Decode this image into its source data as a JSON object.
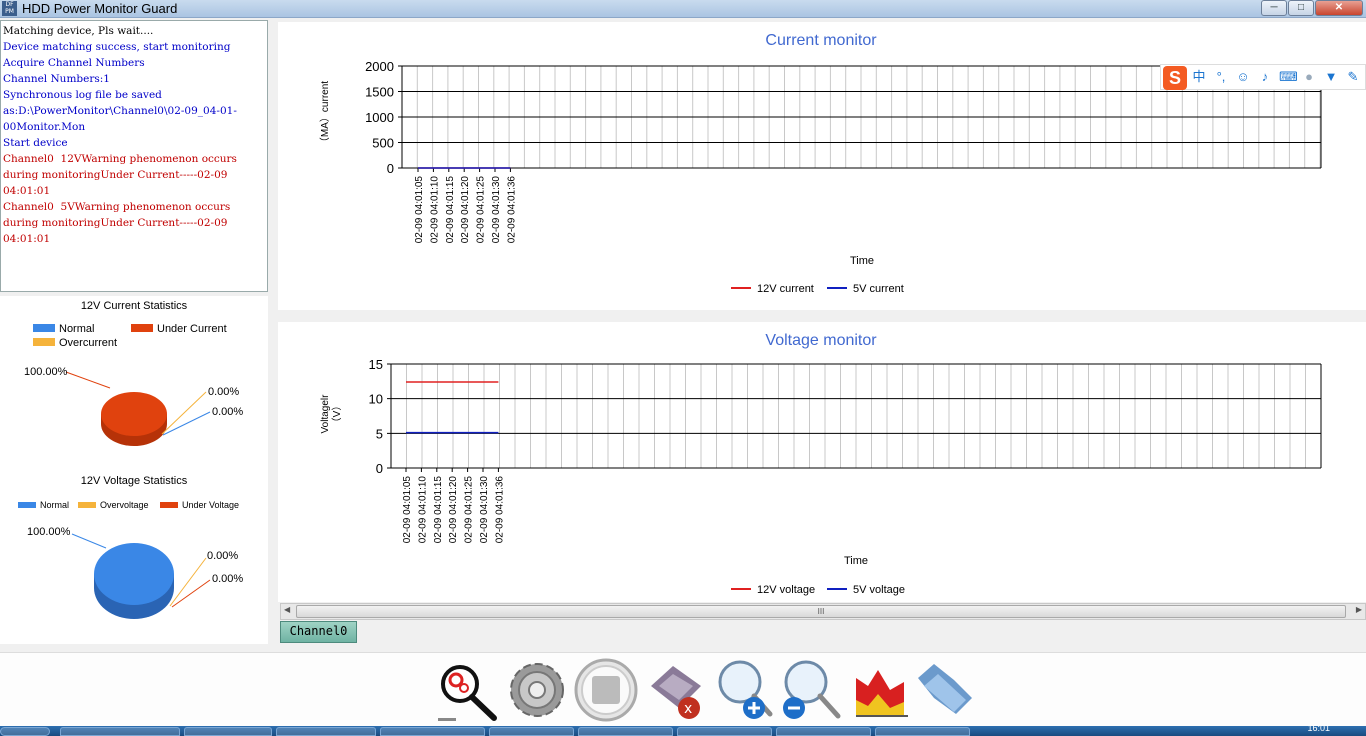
{
  "window": {
    "title": "HDD Power  Monitor Guard",
    "icon_text": "DF\nPM",
    "min": "─",
    "max": "□",
    "close": "✕"
  },
  "log": [
    {
      "text": "Matching device, Pls wait....",
      "color": "black"
    },
    {
      "text": "Device matching success, start monitoring",
      "color": "blue"
    },
    {
      "text": "Acquire Channel Numbers",
      "color": "blue"
    },
    {
      "text": "Channel Numbers:1",
      "color": "blue"
    },
    {
      "text": "Synchronous log file be saved as:D:\\PowerMonitor\\Channel0\\02-09_04-01-00Monitor.Mon",
      "color": "blue"
    },
    {
      "text": "Start device",
      "color": "blue"
    },
    {
      "text": "Channel0  12VWarning phenomenon occurs during monitoringUnder Current-----02-09 04:01:01",
      "color": "red"
    },
    {
      "text": "Channel0  5VWarning phenomenon occurs during monitoringUnder Current-----02-09 04:01:01",
      "color": "red"
    }
  ],
  "current_stats": {
    "title": "12V Current Statistics",
    "legend": [
      {
        "label": "Normal",
        "color": "#3a87e6"
      },
      {
        "label": "Under Current",
        "color": "#e0420e"
      },
      {
        "label": "Overcurrent",
        "color": "#f5b33b"
      }
    ],
    "labels": [
      "100.00%",
      "0.00%",
      "0.00%"
    ]
  },
  "voltage_stats": {
    "title": "12V Voltage Statistics",
    "legend": [
      {
        "label": "Normal",
        "color": "#3a87e6"
      },
      {
        "label": "Overvoltage",
        "color": "#f5b33b"
      },
      {
        "label": "Under Voltage",
        "color": "#e0420e"
      }
    ],
    "labels": [
      "100.00%",
      "0.00%",
      "0.00%"
    ]
  },
  "chart_data": [
    {
      "type": "line",
      "title": "Current monitor",
      "xlabel": "Time",
      "ylabel": "（MA）current",
      "ylim": [
        0,
        2000
      ],
      "yticks": [
        0,
        500,
        1000,
        1500,
        2000
      ],
      "x": [
        "02-09 04:01:05",
        "02-09 04:01:10",
        "02-09 04:01:15",
        "02-09 04:01:20",
        "02-09 04:01:25",
        "02-09 04:01:30",
        "02-09 04:01:36"
      ],
      "series": [
        {
          "name": "12V current",
          "color": "#e02020",
          "values": [
            0,
            0,
            0,
            0,
            0,
            0,
            0
          ]
        },
        {
          "name": "5V current",
          "color": "#1020c0",
          "values": [
            0,
            0,
            0,
            0,
            0,
            0,
            0
          ]
        }
      ],
      "grid": true
    },
    {
      "type": "line",
      "title": "Voltage monitor",
      "xlabel": "Time",
      "ylabel": "Voltagelr\n（V）",
      "ylim": [
        0,
        15
      ],
      "yticks": [
        0,
        5,
        10,
        15
      ],
      "x": [
        "02-09 04:01:05",
        "02-09 04:01:10",
        "02-09 04:01:15",
        "02-09 04:01:20",
        "02-09 04:01:25",
        "02-09 04:01:30",
        "02-09 04:01:36"
      ],
      "series": [
        {
          "name": "12V voltage",
          "color": "#e02020",
          "values": [
            12.4,
            12.4,
            12.4,
            12.4,
            12.4,
            12.4,
            12.4
          ]
        },
        {
          "name": "5V voltage",
          "color": "#1020c0",
          "values": [
            5.1,
            5.1,
            5.1,
            5.1,
            5.1,
            5.1,
            5.1
          ]
        }
      ],
      "grid": true
    }
  ],
  "tab": {
    "label": "Channel0"
  },
  "scrollbar": {
    "thumb_grip": "III",
    "left_arrow": "◀",
    "right_arrow": "▶"
  },
  "toolbar": [
    {
      "name": "search-device-button",
      "icon": "magnifier-gear-icon"
    },
    {
      "name": "settings-button",
      "icon": "gear-icon"
    },
    {
      "name": "stop-button",
      "icon": "stop-icon"
    },
    {
      "name": "clear-button",
      "icon": "eraser-icon"
    },
    {
      "name": "zoom-in-button",
      "icon": "zoom-in-icon"
    },
    {
      "name": "zoom-out-button",
      "icon": "zoom-out-icon"
    },
    {
      "name": "chart-button",
      "icon": "chart-icon"
    },
    {
      "name": "open-folder-button",
      "icon": "folder-icon"
    }
  ],
  "taskbar": {
    "clock": "16:01"
  }
}
